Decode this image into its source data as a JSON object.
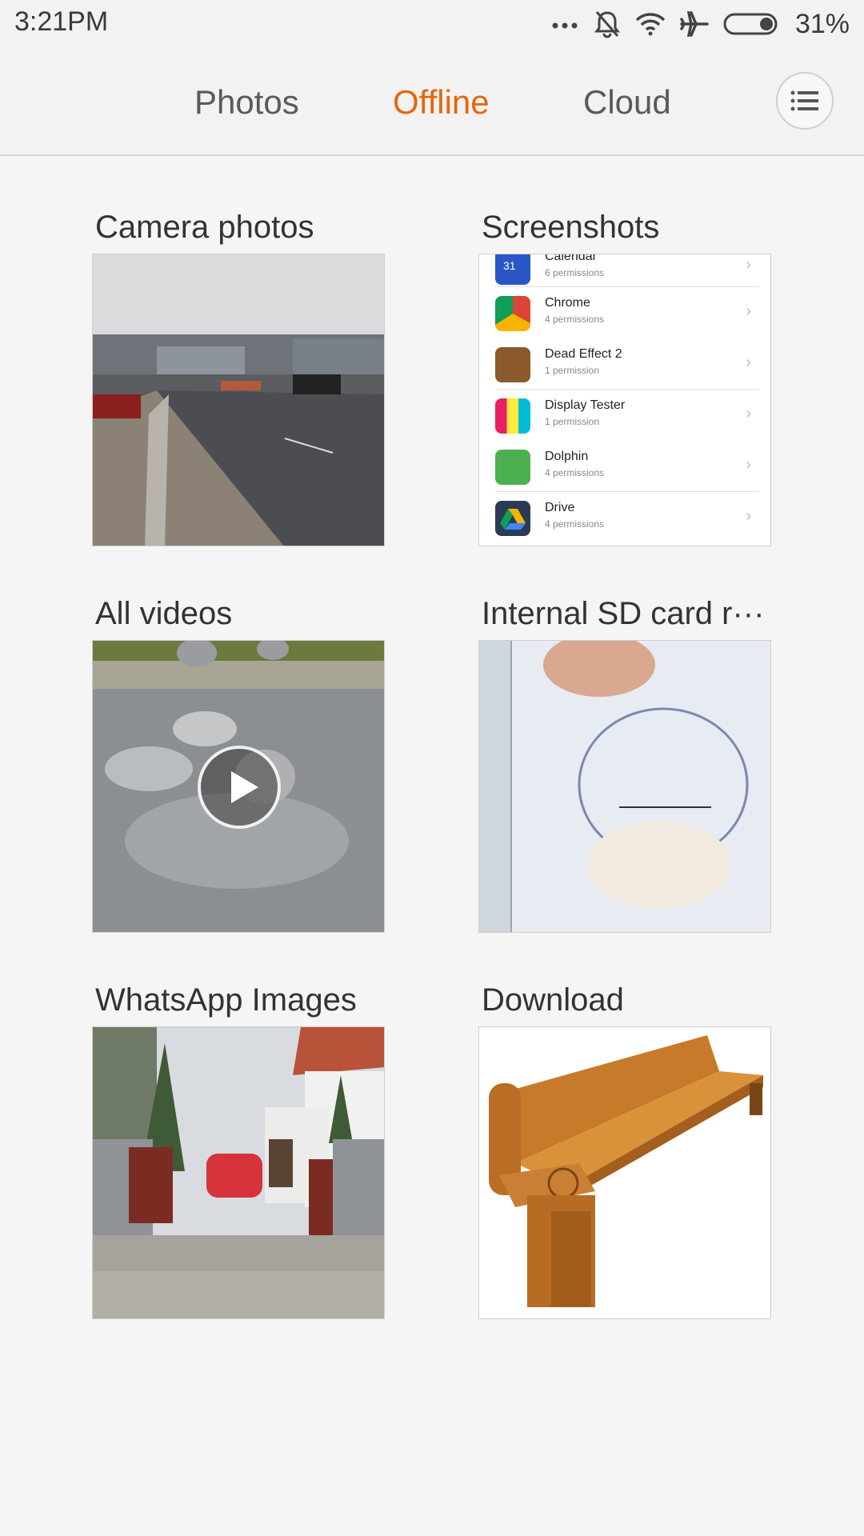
{
  "status_bar": {
    "time": "3:21PM",
    "battery_percent": "31%",
    "icons": [
      "more-dots-icon",
      "silent-bell-icon",
      "wifi-icon",
      "airplane-mode-icon",
      "battery-icon"
    ]
  },
  "tabs": [
    {
      "label": "Photos",
      "active": false
    },
    {
      "label": "Offline",
      "active": true
    },
    {
      "label": "Cloud",
      "active": false
    }
  ],
  "accent_color": "#e8650c",
  "menu_icon": "list-menu-icon",
  "albums": [
    {
      "title": "Camera photos",
      "thumbnail": "street-photo"
    },
    {
      "title": "Screenshots",
      "thumbnail": "app-permissions-list"
    },
    {
      "title": "All videos",
      "thumbnail": "pigeons-video",
      "badge_icon": "play-icon"
    },
    {
      "title": "Internal SD card r···",
      "thumbnail": "passport-stamp"
    },
    {
      "title": "WhatsApp Images",
      "thumbnail": "house-driveway"
    },
    {
      "title": "Download",
      "thumbnail": "wooden-bench"
    }
  ],
  "screenshot_list": [
    {
      "name": "Calendar",
      "sub": "6 permissions",
      "icon": "calendar-icon"
    },
    {
      "name": "Chrome",
      "sub": "4 permissions",
      "icon": "chrome-icon"
    },
    {
      "name": "Dead Effect 2",
      "sub": "1 permission",
      "icon": "dead-effect-icon"
    },
    {
      "name": "Display Tester",
      "sub": "1 permission",
      "icon": "display-tester-icon"
    },
    {
      "name": "Dolphin",
      "sub": "4 permissions",
      "icon": "dolphin-icon"
    },
    {
      "name": "Drive",
      "sub": "4 permissions",
      "icon": "drive-icon"
    }
  ],
  "calendar_day": "31"
}
